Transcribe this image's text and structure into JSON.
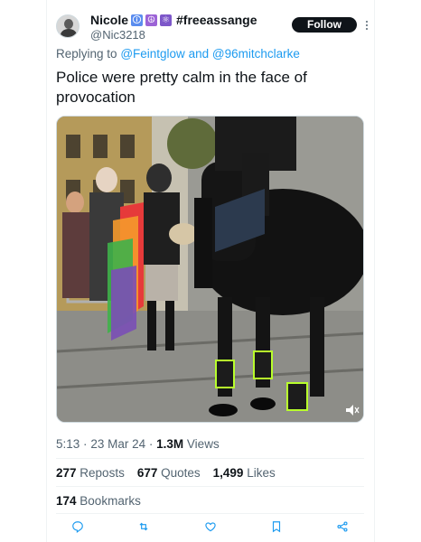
{
  "author": {
    "display_name": "Nicole",
    "emoji_badges": [
      "🛈",
      "☮",
      "⚛"
    ],
    "hashtag": "#freeassange",
    "handle": "@Nic3218",
    "follow_label": "Follow"
  },
  "reply_context": {
    "prefix": "Replying to",
    "user1": "@Feintglow",
    "connector": "and",
    "user2": "@96mitchclarke"
  },
  "tweet": {
    "text": "Police were pretty calm in the face of provocation"
  },
  "meta": {
    "time": "5:13",
    "separator": "·",
    "date": "23 Mar 24",
    "views_count": "1.3M",
    "views_label": "Views"
  },
  "stats": {
    "reposts_count": "277",
    "reposts_label": "Reposts",
    "quotes_count": "677",
    "quotes_label": "Quotes",
    "likes_count": "1,499",
    "likes_label": "Likes",
    "bookmarks_count": "174",
    "bookmarks_label": "Bookmarks"
  },
  "actions": [
    "reply-icon",
    "repost-icon",
    "like-icon",
    "bookmark-icon",
    "share-icon"
  ],
  "colors": {
    "link": "#1d9bf0",
    "text": "#0f1419",
    "secondary": "#536471",
    "border": "#eff3f4",
    "follow_bg": "#0f1419"
  }
}
